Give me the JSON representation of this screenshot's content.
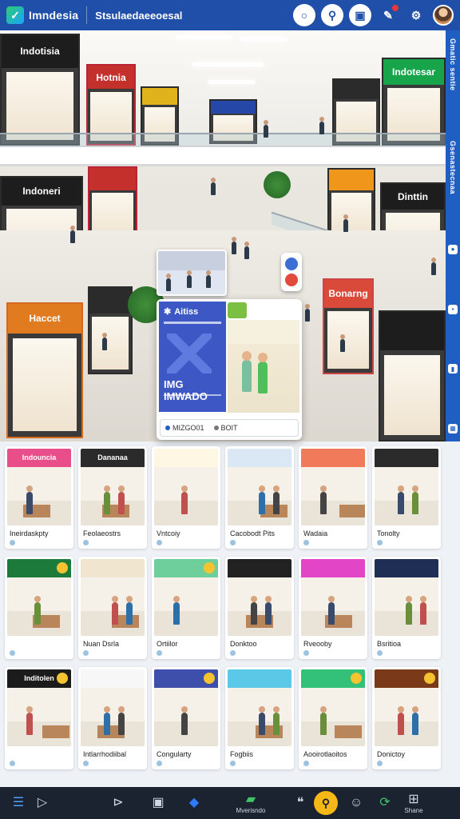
{
  "topbar": {
    "logo_text": "Imndesia",
    "screen_title": "Stsulaedaeeoesal",
    "icons": [
      "circle-icon",
      "pin-icon",
      "bus-icon",
      "notification-icon",
      "settings-icon",
      "avatar"
    ]
  },
  "hero": {
    "store_signs": [
      "Indotisia",
      "Hotnia",
      "Indotesar",
      "Indoneri",
      "Dinttin",
      "Haccet",
      "Bonarng"
    ],
    "side_labels": [
      "Gmatic sentie",
      "Gsenastecnaa"
    ]
  },
  "feature_card": {
    "heading": "Aitiss",
    "big_text": "IMG IMWADO",
    "foot_left": "MIZGO01",
    "foot_right": "BOIT"
  },
  "tiles": [
    {
      "label": "Ineirdaskpty",
      "sign": "Indouncia",
      "sign_color": "#e84f8a"
    },
    {
      "label": "Feolaeostrs",
      "sign": "Dananaa",
      "sign_color": "#2b2b2b"
    },
    {
      "label": "Vntcoiy",
      "sign": "",
      "sign_color": "#fdf7e3"
    },
    {
      "label": "Cacobodt Pits",
      "sign": "",
      "sign_color": "#d9e8f4"
    },
    {
      "label": "Wadaia",
      "sign": "",
      "sign_color": "#f07a5a"
    },
    {
      "label": "Tonolty",
      "sign": "",
      "sign_color": "#2b2b2b"
    },
    {
      "label": "",
      "sign": "",
      "sign_color": "#1c7a3b"
    },
    {
      "label": "Nuan Dsrla",
      "sign": "",
      "sign_color": "#f0e6cf"
    },
    {
      "label": "Ortiilor",
      "sign": "",
      "sign_color": "#6fcf9c"
    },
    {
      "label": "Donktoo",
      "sign": "",
      "sign_color": "#222222"
    },
    {
      "label": "Rveooby",
      "sign": "",
      "sign_color": "#e246c6"
    },
    {
      "label": "Bsritioa",
      "sign": "",
      "sign_color": "#1f2e55"
    },
    {
      "label": "",
      "sign": "Inditolen",
      "sign_color": "#1b1b1b"
    },
    {
      "label": "Intlarrhodiibal",
      "sign": "",
      "sign_color": "#f7f7f7"
    },
    {
      "label": "Congularty",
      "sign": "",
      "sign_color": "#3d4faa"
    },
    {
      "label": "Fogbiis",
      "sign": "",
      "sign_color": "#5cc8e8"
    },
    {
      "label": "Aooirotlaoitos",
      "sign": "",
      "sign_color": "#33c17a"
    },
    {
      "label": "Donictoy",
      "sign": "",
      "sign_color": "#7a3a1a"
    }
  ],
  "bottombar": {
    "items": [
      {
        "icon": "menu-icon",
        "label": ""
      },
      {
        "icon": "play-icon",
        "label": ""
      },
      {
        "icon": "forward-icon",
        "label": ""
      },
      {
        "icon": "bookmark-icon",
        "label": ""
      },
      {
        "icon": "feather-icon",
        "label": ""
      },
      {
        "icon": "chat-icon",
        "label": "Mverisndo"
      },
      {
        "icon": "quote-icon",
        "label": ""
      },
      {
        "icon": "search-icon",
        "label": ""
      },
      {
        "icon": "face-icon",
        "label": ""
      },
      {
        "icon": "share-icon",
        "label": ""
      },
      {
        "icon": "grid-icon",
        "label": "Shane"
      }
    ]
  }
}
